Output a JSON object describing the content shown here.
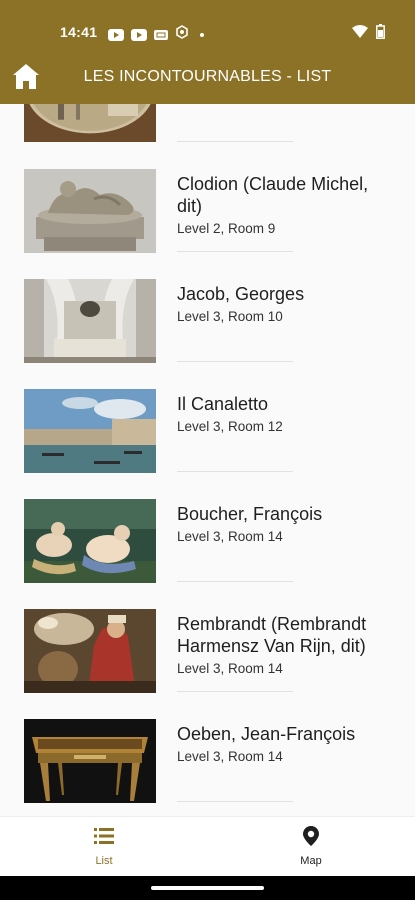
{
  "status_bar": {
    "time": "14:41",
    "notification_icons": [
      "youtube-icon",
      "youtube-icon",
      "cast-icon",
      "settings-icon"
    ],
    "system_icons": [
      "wifi-icon",
      "battery-icon"
    ]
  },
  "app_bar": {
    "title": "LES INCONTOURNABLES - LIST",
    "home_icon": "home-icon",
    "background": "#8c7226"
  },
  "items": [
    {
      "name": "",
      "location": "",
      "thumb": "painting-partial"
    },
    {
      "name": "Clodion (Claude Michel, dit)",
      "location": "Level 2, Room 9",
      "thumb": "sculpture"
    },
    {
      "name": "Jacob, Georges",
      "location": "Level 3, Room 10",
      "thumb": "bed"
    },
    {
      "name": "Il Canaletto",
      "location": "Level 3, Room 12",
      "thumb": "venice"
    },
    {
      "name": "Boucher, François",
      "location": "Level 3, Room 14",
      "thumb": "bathers"
    },
    {
      "name": "Rembrandt (Rembrandt Harmensz Van Rijn, dit)",
      "location": "Level 3, Room 14",
      "thumb": "rembrandt"
    },
    {
      "name": "Oeben, Jean-François",
      "location": "Level 3, Room 14",
      "thumb": "desk"
    }
  ],
  "bottom_nav": {
    "list_label": "List",
    "map_label": "Map",
    "active": "List",
    "active_color": "#8c7226"
  }
}
